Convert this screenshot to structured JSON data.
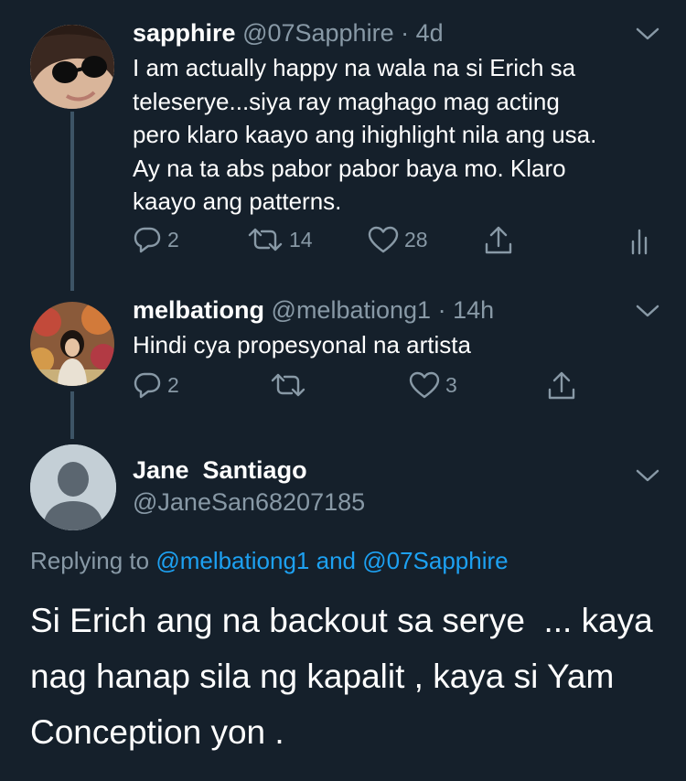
{
  "tweets": [
    {
      "name": "sapphire",
      "handle": "@07Sapphire",
      "dot": "·",
      "time": "4d",
      "lines": [
        "I am actually happy na wala na si Erich sa",
        "teleserye...siya ray maghago mag acting",
        "pero klaro kaayo ang ihighlight nila ang usa.",
        "Ay na ta abs pabor pabor baya mo. Klaro",
        "kaayo ang patterns."
      ],
      "reply_count": "2",
      "retweet_count": "14",
      "like_count": "28"
    },
    {
      "name": "melbationg",
      "handle": "@melbationg1",
      "dot": "·",
      "time": "14h",
      "lines": [
        "Hindi cya propesyonal na artista"
      ],
      "reply_count": "2",
      "retweet_count": "",
      "like_count": "3"
    }
  ],
  "main_tweet": {
    "name": "Jane  Santiago",
    "handle": "@JaneSan68207185",
    "replying_prefix": "Replying to",
    "mention1": "@melbationg1",
    "replying_and": "and",
    "mention2": "@07Sapphire",
    "lines": [
      "Si Erich ang na backout sa serye  ... kaya",
      "nag hanap sila ng kapalit , kaya si Yam",
      "Conception yon ."
    ]
  },
  "icons": {
    "reply": "reply-icon",
    "retweet": "retweet-icon",
    "like": "heart-icon",
    "share": "share-icon",
    "analytics": "analytics-icon",
    "more": "chevron-down-icon"
  },
  "colors": {
    "background": "#15202b",
    "text": "#ffffff",
    "secondary": "#8899a6",
    "link": "#1da1f2",
    "thread_line": "#3d5466"
  }
}
